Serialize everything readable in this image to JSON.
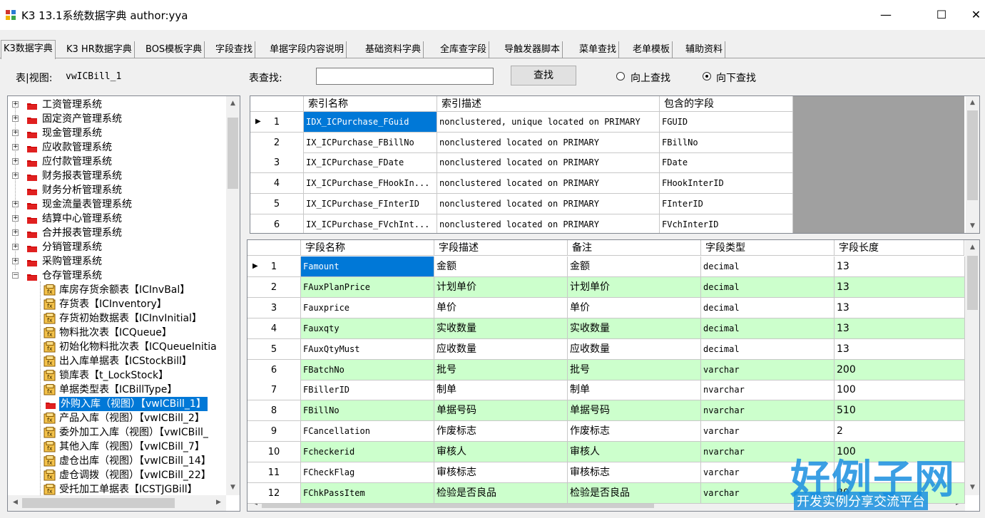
{
  "window": {
    "title": "K3   13.1系统数据字典 author:yya",
    "minimize": "—",
    "maximize": "☐",
    "close": "✕"
  },
  "tabs": [
    {
      "label": "K3数据字典",
      "active": true
    },
    {
      "label": "K3 HR数据字典"
    },
    {
      "label": "BOS模板字典"
    },
    {
      "label": "字段查找"
    },
    {
      "label": "单据字段内容说明"
    },
    {
      "label": "基础资料字典"
    },
    {
      "label": "全库查字段"
    },
    {
      "label": "导触发器脚本"
    },
    {
      "label": "菜单查找"
    },
    {
      "label": "老单模板"
    },
    {
      "label": "辅助资料"
    }
  ],
  "left": {
    "view_label": "表|视图:",
    "view_value": "vwICBill_1"
  },
  "search": {
    "label": "表查找:",
    "value": "",
    "button": "查找",
    "radio_up": "向上查找",
    "radio_down": "向下查找",
    "selected": "down"
  },
  "tree": {
    "groups": [
      "工资管理系统",
      "固定资产管理系统",
      "现金管理系统",
      "应收款管理系统",
      "应付款管理系统",
      "财务报表管理系统",
      "财务分析管理系统",
      "现金流量表管理系统",
      "结算中心管理系统",
      "合并报表管理系统",
      "分销管理系统",
      "采购管理系统",
      "仓存管理系统"
    ],
    "children": [
      "库房存货余额表【ICInvBal】",
      "存货表【ICInventory】",
      "存货初始数据表【ICInvInitial】",
      "物料批次表【ICQueue】",
      "初始化物料批次表【ICQueueInitia",
      "出入库单据表【ICStockBill】",
      "锁库表【t_LockStock】",
      "单据类型表【ICBillType】",
      "外购入库（视图）【vwICBill_1】",
      "产品入库（视图）【vwICBill_2】",
      "委外加工入库（视图）【vwICBill_",
      "其他入库（视图）【vwICBill_7】",
      "虚仓出库（视图）【vwICBill_14】",
      "虚仓调拨（视图）【vwICBill_22】",
      "受托加工单据表【ICSTJGBill】"
    ],
    "selected_child": 8
  },
  "index_grid": {
    "columns": [
      "索引名称",
      "索引描述",
      "包含的字段"
    ],
    "rows": [
      [
        "1",
        "IDX_ICPurchase_FGuid",
        "nonclustered, unique located on PRIMARY",
        "FGUID"
      ],
      [
        "2",
        "IX_ICPurchase_FBillNo",
        "nonclustered located on PRIMARY",
        "FBillNo"
      ],
      [
        "3",
        "IX_ICPurchase_FDate",
        "nonclustered located on PRIMARY",
        "FDate"
      ],
      [
        "4",
        "IX_ICPurchase_FHookIn...",
        "nonclustered located on PRIMARY",
        "FHookInterID"
      ],
      [
        "5",
        "IX_ICPurchase_FInterID",
        "nonclustered located on PRIMARY",
        "FInterID"
      ],
      [
        "6",
        "IX_ICPurchase_FVchInt...",
        "nonclustered located on PRIMARY",
        "FVchInterID"
      ]
    ]
  },
  "field_grid": {
    "columns": [
      "字段名称",
      "字段描述",
      "备注",
      "字段类型",
      "字段长度"
    ],
    "rows": [
      [
        "1",
        "Famount",
        "金额",
        "金额",
        "decimal",
        "13"
      ],
      [
        "2",
        "FAuxPlanPrice",
        "计划单价",
        "计划单价",
        "decimal",
        "13"
      ],
      [
        "3",
        "Fauxprice",
        "单价",
        "单价",
        "decimal",
        "13"
      ],
      [
        "4",
        "Fauxqty",
        "实收数量",
        "实收数量",
        "decimal",
        "13"
      ],
      [
        "5",
        "FAuxQtyMust",
        "应收数量",
        "应收数量",
        "decimal",
        "13"
      ],
      [
        "6",
        "FBatchNo",
        "批号",
        "批号",
        "varchar",
        "200"
      ],
      [
        "7",
        "FBillerID",
        "制单",
        "制单",
        "nvarchar",
        "100"
      ],
      [
        "8",
        "FBillNo",
        "单据号码",
        "单据号码",
        "nvarchar",
        "510"
      ],
      [
        "9",
        "FCancellation",
        "作废标志",
        "作废标志",
        "varchar",
        "2"
      ],
      [
        "10",
        "Fcheckerid",
        "审核人",
        "审核人",
        "nvarchar",
        "100"
      ],
      [
        "11",
        "FCheckFlag",
        "审核标志",
        "审核标志",
        "varchar",
        ""
      ],
      [
        "12",
        "FChkPassItem",
        "检验是否良品",
        "检验是否良品",
        "varchar",
        "80"
      ]
    ]
  },
  "watermark": {
    "big": "好例子网",
    "small": "开发实例分享交流平台"
  },
  "colors": {
    "selection": "#0078d7",
    "alt_row": "#ccffcc",
    "folder": "#cc0000"
  }
}
